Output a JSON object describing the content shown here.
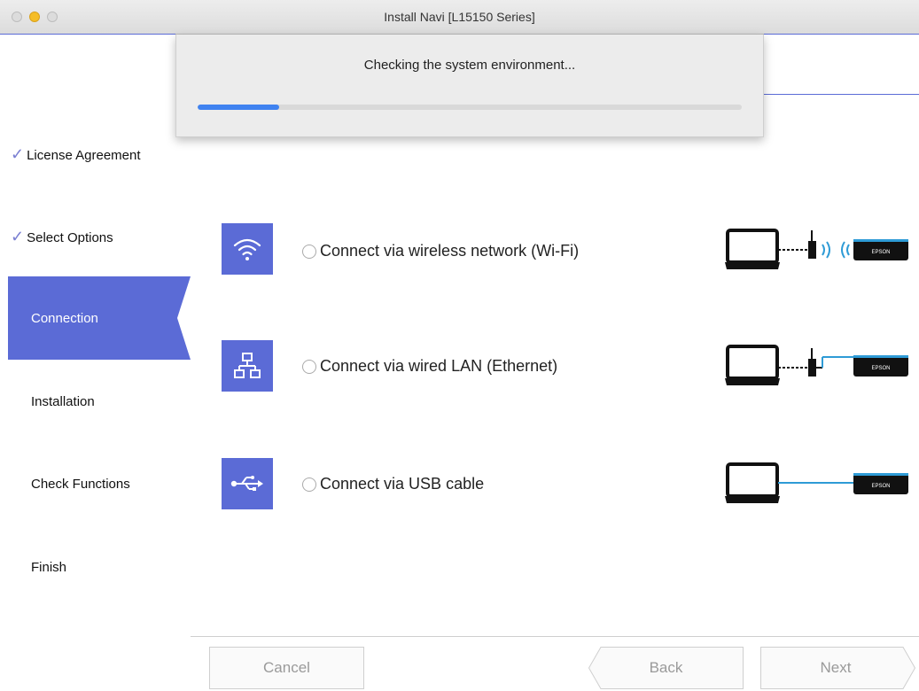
{
  "window": {
    "title": "Install Navi [L15150 Series]"
  },
  "sheet": {
    "message": "Checking the system environment...",
    "progress": 0.15
  },
  "sidebar": {
    "steps": [
      {
        "label": "License Agreement",
        "state": "done"
      },
      {
        "label": "Select Options",
        "state": "done"
      },
      {
        "label": "Connection",
        "state": "active"
      },
      {
        "label": "Installation",
        "state": "pending"
      },
      {
        "label": "Check Functions",
        "state": "pending"
      },
      {
        "label": "Finish",
        "state": "pending"
      }
    ],
    "check_glyph": "✓"
  },
  "options": [
    {
      "label": "Connect via wireless network (Wi-Fi)",
      "icon": "wifi-icon"
    },
    {
      "label": "Connect via wired LAN (Ethernet)",
      "icon": "network-icon"
    },
    {
      "label": "Connect via USB cable",
      "icon": "usb-icon"
    }
  ],
  "diagram": {
    "printer_label": "EPSON"
  },
  "footer": {
    "cancel_label": "Cancel",
    "back_label": "Back",
    "next_label": "Next"
  },
  "colors": {
    "accent": "#5b6bd6",
    "progress": "#3f82f0",
    "cable": "#2e9bd6"
  }
}
